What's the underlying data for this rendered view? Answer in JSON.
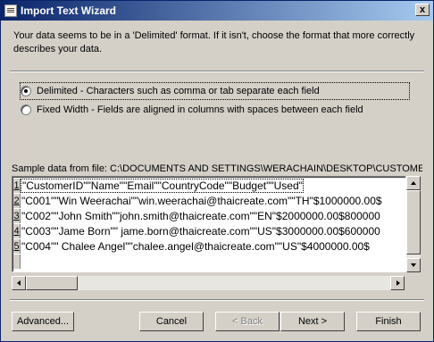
{
  "window": {
    "title": "Import Text Wizard",
    "close_glyph": "x"
  },
  "description": "Your data seems to be in a 'Delimited' format. If it isn't, choose the format that more correctly describes your data.",
  "format_options": [
    {
      "label": "Delimited - Characters such as comma or tab separate each field",
      "selected": true
    },
    {
      "label": "Fixed Width - Fields are aligned in columns with spaces between each field",
      "selected": false
    }
  ],
  "sample_label": "Sample data from file: C:\\DOCUMENTS AND SETTINGS\\WERACHAIN\\DESKTOP\\CUSTOMER.",
  "sample_rows": [
    {
      "num": "1",
      "text": "\"CustomerID\"\"Name\"\"Email\"\"CountryCode\"\"Budget\"\"Used\""
    },
    {
      "num": "2",
      "text": "\"C001\"\"Win Weerachai\"\"win.weerachai@thaicreate.com\"\"TH\"$1000000.00$"
    },
    {
      "num": "3",
      "text": "\"C002\"\"John Smith\"\"john.smith@thaicreate.com\"\"EN\"$2000000.00$800000"
    },
    {
      "num": "4",
      "text": "\"C003\"\"Jame Born\"\" jame.born@thaicreate.com\"\"US\"$3000000.00$600000"
    },
    {
      "num": "5",
      "text": "\"C004\"\" Chalee Angel\"\"chalee.angel@thaicreate.com\"\"US\"$4000000.00$"
    }
  ],
  "buttons": {
    "advanced": "Advanced...",
    "cancel": "Cancel",
    "back": "< Back",
    "next": "Next >",
    "finish": "Finish"
  },
  "icons": {
    "title": "import-wizard-icon",
    "close": "close-icon"
  }
}
